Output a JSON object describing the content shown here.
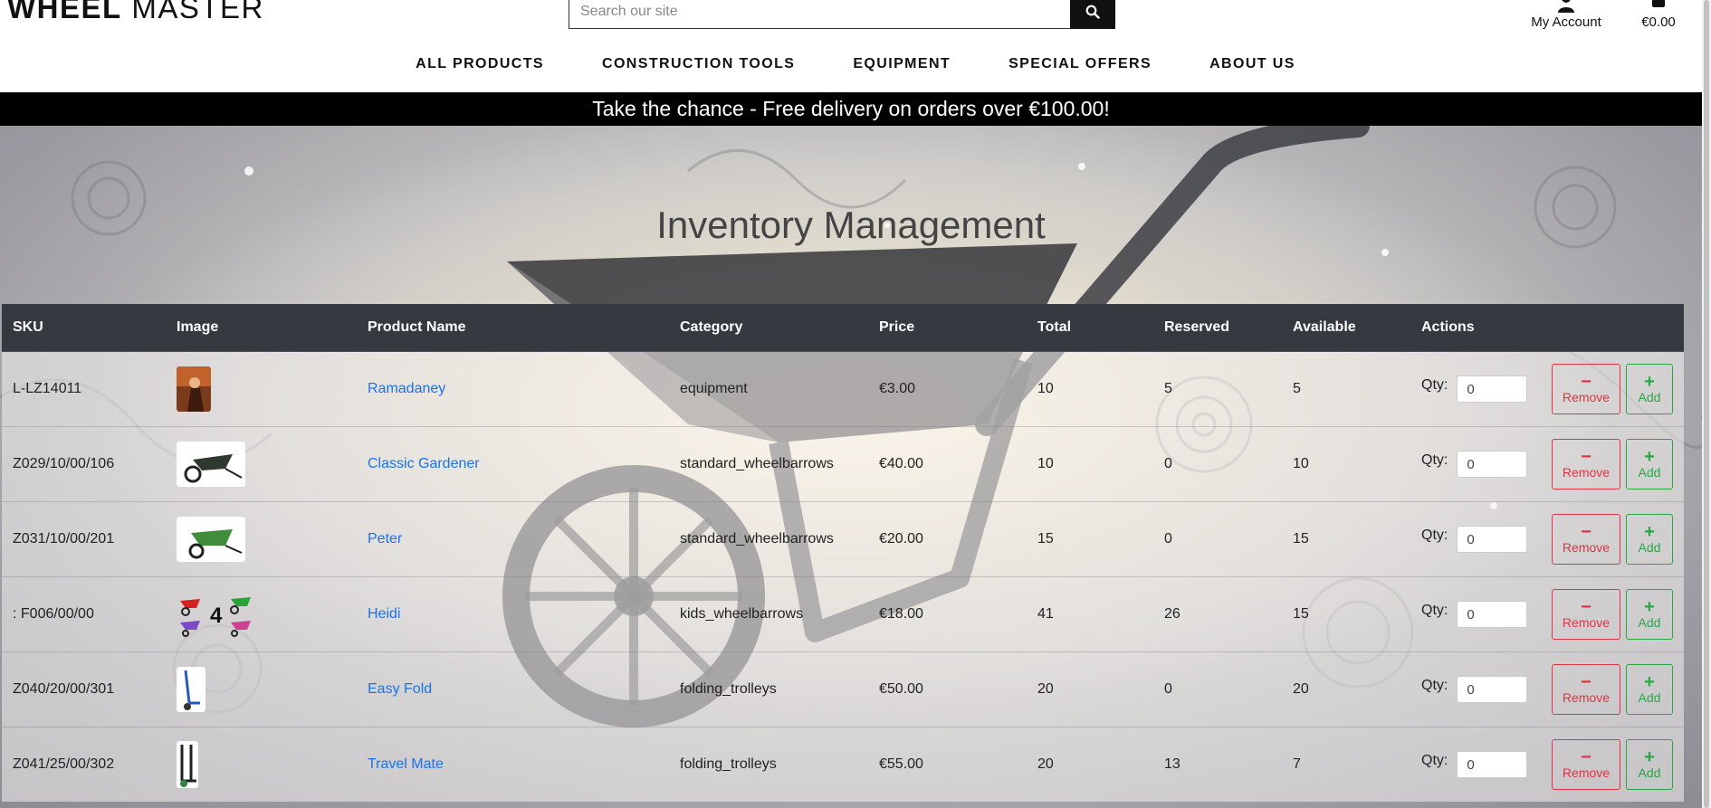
{
  "header": {
    "logo_bold": "WHEEL",
    "logo_light": "MASTER",
    "search_placeholder": "Search our site",
    "account_label": "My Account",
    "cart_total": "€0.00"
  },
  "nav": [
    "ALL PRODUCTS",
    "CONSTRUCTION TOOLS",
    "EQUIPMENT",
    "SPECIAL OFFERS",
    "ABOUT US"
  ],
  "banner": "Take the chance - Free delivery on orders over €100.00!",
  "page_title": "Inventory Management",
  "table": {
    "columns": [
      "SKU",
      "Image",
      "Product Name",
      "Category",
      "Price",
      "Total",
      "Reserved",
      "Available",
      "Actions"
    ],
    "qty_label": "Qty:",
    "remove_label": "Remove",
    "add_label": "Add",
    "rows": [
      {
        "sku": "L-LZ14011",
        "name": "Ramadaney",
        "category": "equipment",
        "price": "€3.00",
        "total": "10",
        "reserved": "5",
        "available": "5",
        "qty": "0"
      },
      {
        "sku": "Z029/10/00/106",
        "name": "Classic Gardener",
        "category": "standard_wheelbarrows",
        "price": "€40.00",
        "total": "10",
        "reserved": "0",
        "available": "10",
        "qty": "0"
      },
      {
        "sku": "Z031/10/00/201",
        "name": "Peter",
        "category": "standard_wheelbarrows",
        "price": "€20.00",
        "total": "15",
        "reserved": "0",
        "available": "15",
        "qty": "0"
      },
      {
        "sku": ": F006/00/00",
        "name": "Heidi",
        "category": "kids_wheelbarrows",
        "price": "€18.00",
        "total": "41",
        "reserved": "26",
        "available": "15",
        "qty": "0"
      },
      {
        "sku": "Z040/20/00/301",
        "name": "Easy Fold",
        "category": "folding_trolleys",
        "price": "€50.00",
        "total": "20",
        "reserved": "0",
        "available": "20",
        "qty": "0"
      },
      {
        "sku": "Z041/25/00/302",
        "name": "Travel Mate",
        "category": "folding_trolleys",
        "price": "€55.00",
        "total": "20",
        "reserved": "13",
        "available": "7",
        "qty": "0"
      }
    ]
  },
  "thumb_digit": "4",
  "colors": {
    "accent_link": "#1a73e8",
    "remove": "#dc3545",
    "add": "#28a745",
    "table_header": "#343a40",
    "banner": "#000000"
  },
  "icons": [
    "search-icon",
    "user-icon",
    "shopping-bag-icon",
    "minus-icon",
    "plus-icon"
  ]
}
